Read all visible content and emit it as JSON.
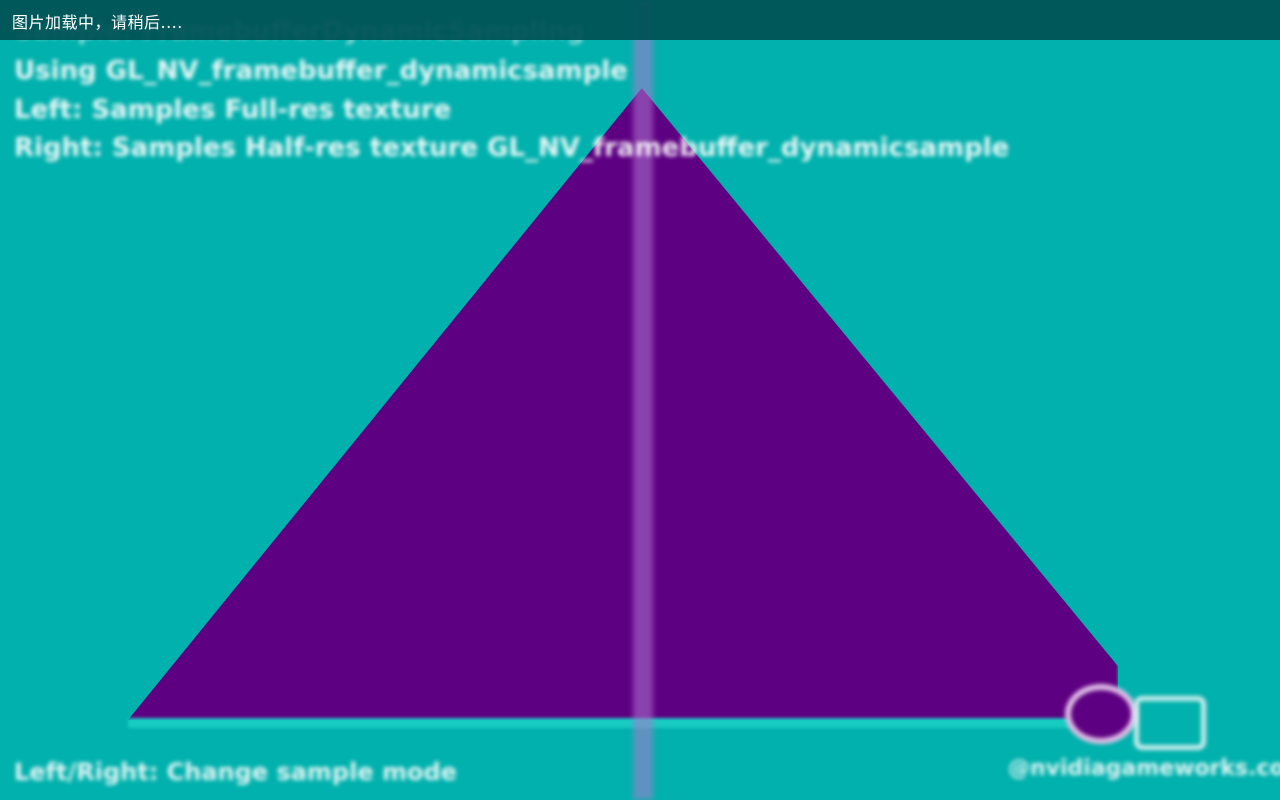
{
  "loading_banner": {
    "text": "图片加载中，请稍后...."
  },
  "overlay": {
    "info_lines": [
      "Sample: FramebufferDynamicSampling",
      "Using GL_NV_framebuffer_dynamicsample",
      "Left: Samples Full-res texture",
      "Right: Samples Half-res texture GL_NV_framebuffer_dynamicsample"
    ],
    "footer_hint": "Left/Right: Change sample mode",
    "watermark": "@nvidiagameworks.com"
  },
  "scene": {
    "background_color": "#00b1ad",
    "triangle_color": "#5e0082",
    "split_line_color": "#b078d2"
  },
  "icons": [
    "camera-toggle-icon",
    "view-mode-icon"
  ]
}
